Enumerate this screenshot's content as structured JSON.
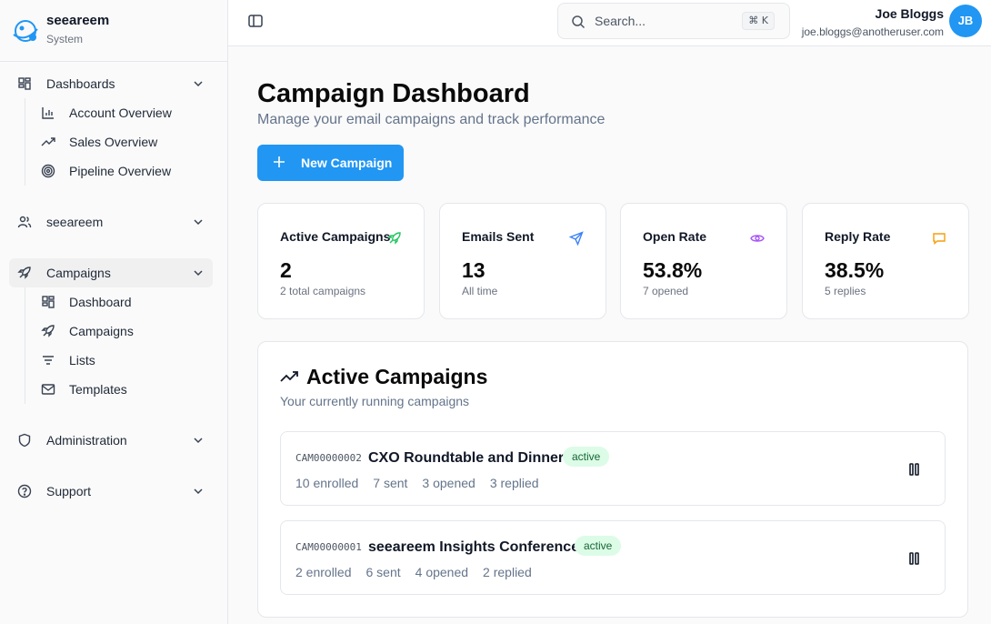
{
  "brand": {
    "name": "seeareem",
    "subtitle": "System"
  },
  "sidebar": {
    "groups": [
      {
        "label": "Dashboards",
        "icon": "grid-icon",
        "items": [
          {
            "label": "Account Overview",
            "icon": "bar-chart-icon"
          },
          {
            "label": "Sales Overview",
            "icon": "trending-up-icon"
          },
          {
            "label": "Pipeline Overview",
            "icon": "target-icon"
          }
        ]
      },
      {
        "label": "seeareem",
        "icon": "users-icon",
        "items": []
      },
      {
        "label": "Campaigns",
        "icon": "rocket-icon",
        "items": [
          {
            "label": "Dashboard",
            "icon": "grid-icon"
          },
          {
            "label": "Campaigns",
            "icon": "rocket-icon"
          },
          {
            "label": "Lists",
            "icon": "filter-icon"
          },
          {
            "label": "Templates",
            "icon": "mail-icon"
          }
        ]
      },
      {
        "label": "Administration",
        "icon": "shield-icon",
        "items": []
      },
      {
        "label": "Support",
        "icon": "help-circle-icon",
        "items": []
      }
    ]
  },
  "topbar": {
    "search_placeholder": "Search...",
    "shortcut": "⌘ K",
    "user_name": "Joe Bloggs",
    "user_email": "joe.bloggs@anotheruser.com",
    "avatar_initials": "JB"
  },
  "page": {
    "title": "Campaign Dashboard",
    "subtitle": "Manage your email campaigns and track performance",
    "new_button": "New Campaign"
  },
  "stats": [
    {
      "title": "Active Campaigns",
      "value": "2",
      "note": "2 total campaigns",
      "icon": "rocket-icon",
      "color": "#22c55e"
    },
    {
      "title": "Emails Sent",
      "value": "13",
      "note": "All time",
      "icon": "send-icon",
      "color": "#3b82f6"
    },
    {
      "title": "Open Rate",
      "value": "53.8%",
      "note": "7 opened",
      "icon": "eye-icon",
      "color": "#a855f7"
    },
    {
      "title": "Reply Rate",
      "value": "38.5%",
      "note": "5 replies",
      "icon": "message-square-icon",
      "color": "#f59e0b"
    }
  ],
  "active_campaigns": {
    "title": "Active Campaigns",
    "subtitle": "Your currently running campaigns",
    "rows": [
      {
        "code": "CAM00000002",
        "name": "CXO Roundtable and Dinner",
        "status": "active",
        "enrolled": "10 enrolled",
        "sent": "7 sent",
        "opened": "3 opened",
        "replied": "3 replied"
      },
      {
        "code": "CAM00000001",
        "name": "seeareem Insights Conference",
        "status": "active",
        "enrolled": "2 enrolled",
        "sent": "6 sent",
        "opened": "4 opened",
        "replied": "2 replied"
      }
    ]
  },
  "colors": {
    "primary": "#2196f3",
    "badge_bg": "#dcfce7",
    "badge_text": "#166534"
  }
}
